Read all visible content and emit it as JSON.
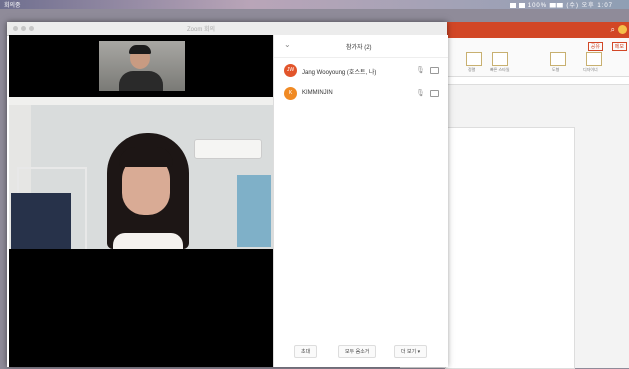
{
  "menubar": {
    "app": "회의중",
    "status": "100% ▆▆  (수) 오후 1:07"
  },
  "zoom": {
    "window_title": "Zoom 회의",
    "participants_panel": {
      "title": "참가자 (2)",
      "participants": [
        {
          "initials": "JW",
          "name": "Jang Wooyoung (호스트, 나)",
          "avatar_color": "#e2552b"
        },
        {
          "initials": "K",
          "name": "KIMMINJIN",
          "avatar_color": "#f08a24"
        }
      ],
      "footer": {
        "invite": "초대",
        "mute_all": "모두 음소거",
        "more": "더 보기 ▾"
      }
    }
  },
  "ppt": {
    "share": "공유",
    "comment": "메모",
    "tool_labels": [
      "정렬",
      "빠른 스타일",
      "도형",
      "디자이너"
    ]
  }
}
